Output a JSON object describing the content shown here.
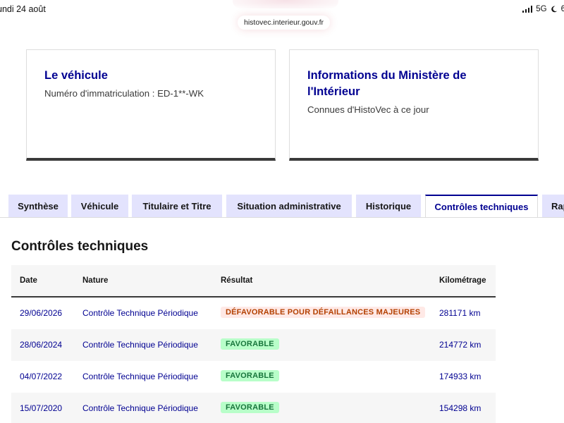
{
  "status_bar": {
    "date": "undi 24 août",
    "network": "5G",
    "battery": "6"
  },
  "browser": {
    "url": "histovec.interieur.gouv.fr"
  },
  "cards": [
    {
      "title": "Le véhicule",
      "desc": "Numéro d'immatriculation : ED-1**-WK"
    },
    {
      "title": "Informations du Ministère de l'Intérieur",
      "desc": "Connues d'HistoVec à ce jour"
    }
  ],
  "tabs": [
    "Synthèse",
    "Véhicule",
    "Titulaire et Titre",
    "Situation administrative",
    "Historique",
    "Contrôles techniques",
    "Rap"
  ],
  "active_tab": "Contrôles techniques",
  "section": {
    "title": "Contrôles techniques"
  },
  "table": {
    "headers": [
      "Date",
      "Nature",
      "Résultat",
      "Kilométrage"
    ],
    "rows": [
      {
        "date": "29/06/2026",
        "nature": "Contrôle Technique Périodique",
        "result": "DÉFAVORABLE POUR DÉFAILLANCES MAJEURES",
        "status": "bad",
        "km": "281171 km"
      },
      {
        "date": "28/06/2024",
        "nature": "Contrôle Technique Périodique",
        "result": "FAVORABLE",
        "status": "good",
        "km": "214772 km"
      },
      {
        "date": "04/07/2022",
        "nature": "Contrôle Technique Périodique",
        "result": "FAVORABLE",
        "status": "good",
        "km": "174933 km"
      },
      {
        "date": "15/07/2020",
        "nature": "Contrôle Technique Périodique",
        "result": "FAVORABLE",
        "status": "good",
        "km": "154298 km"
      }
    ]
  },
  "colors": {
    "primary": "#000091",
    "tab_bg": "#e3e3fd",
    "bad_bg": "#ffe9e6",
    "bad_text": "#b34000",
    "good_bg": "#b8fec9",
    "good_text": "#18753c"
  }
}
